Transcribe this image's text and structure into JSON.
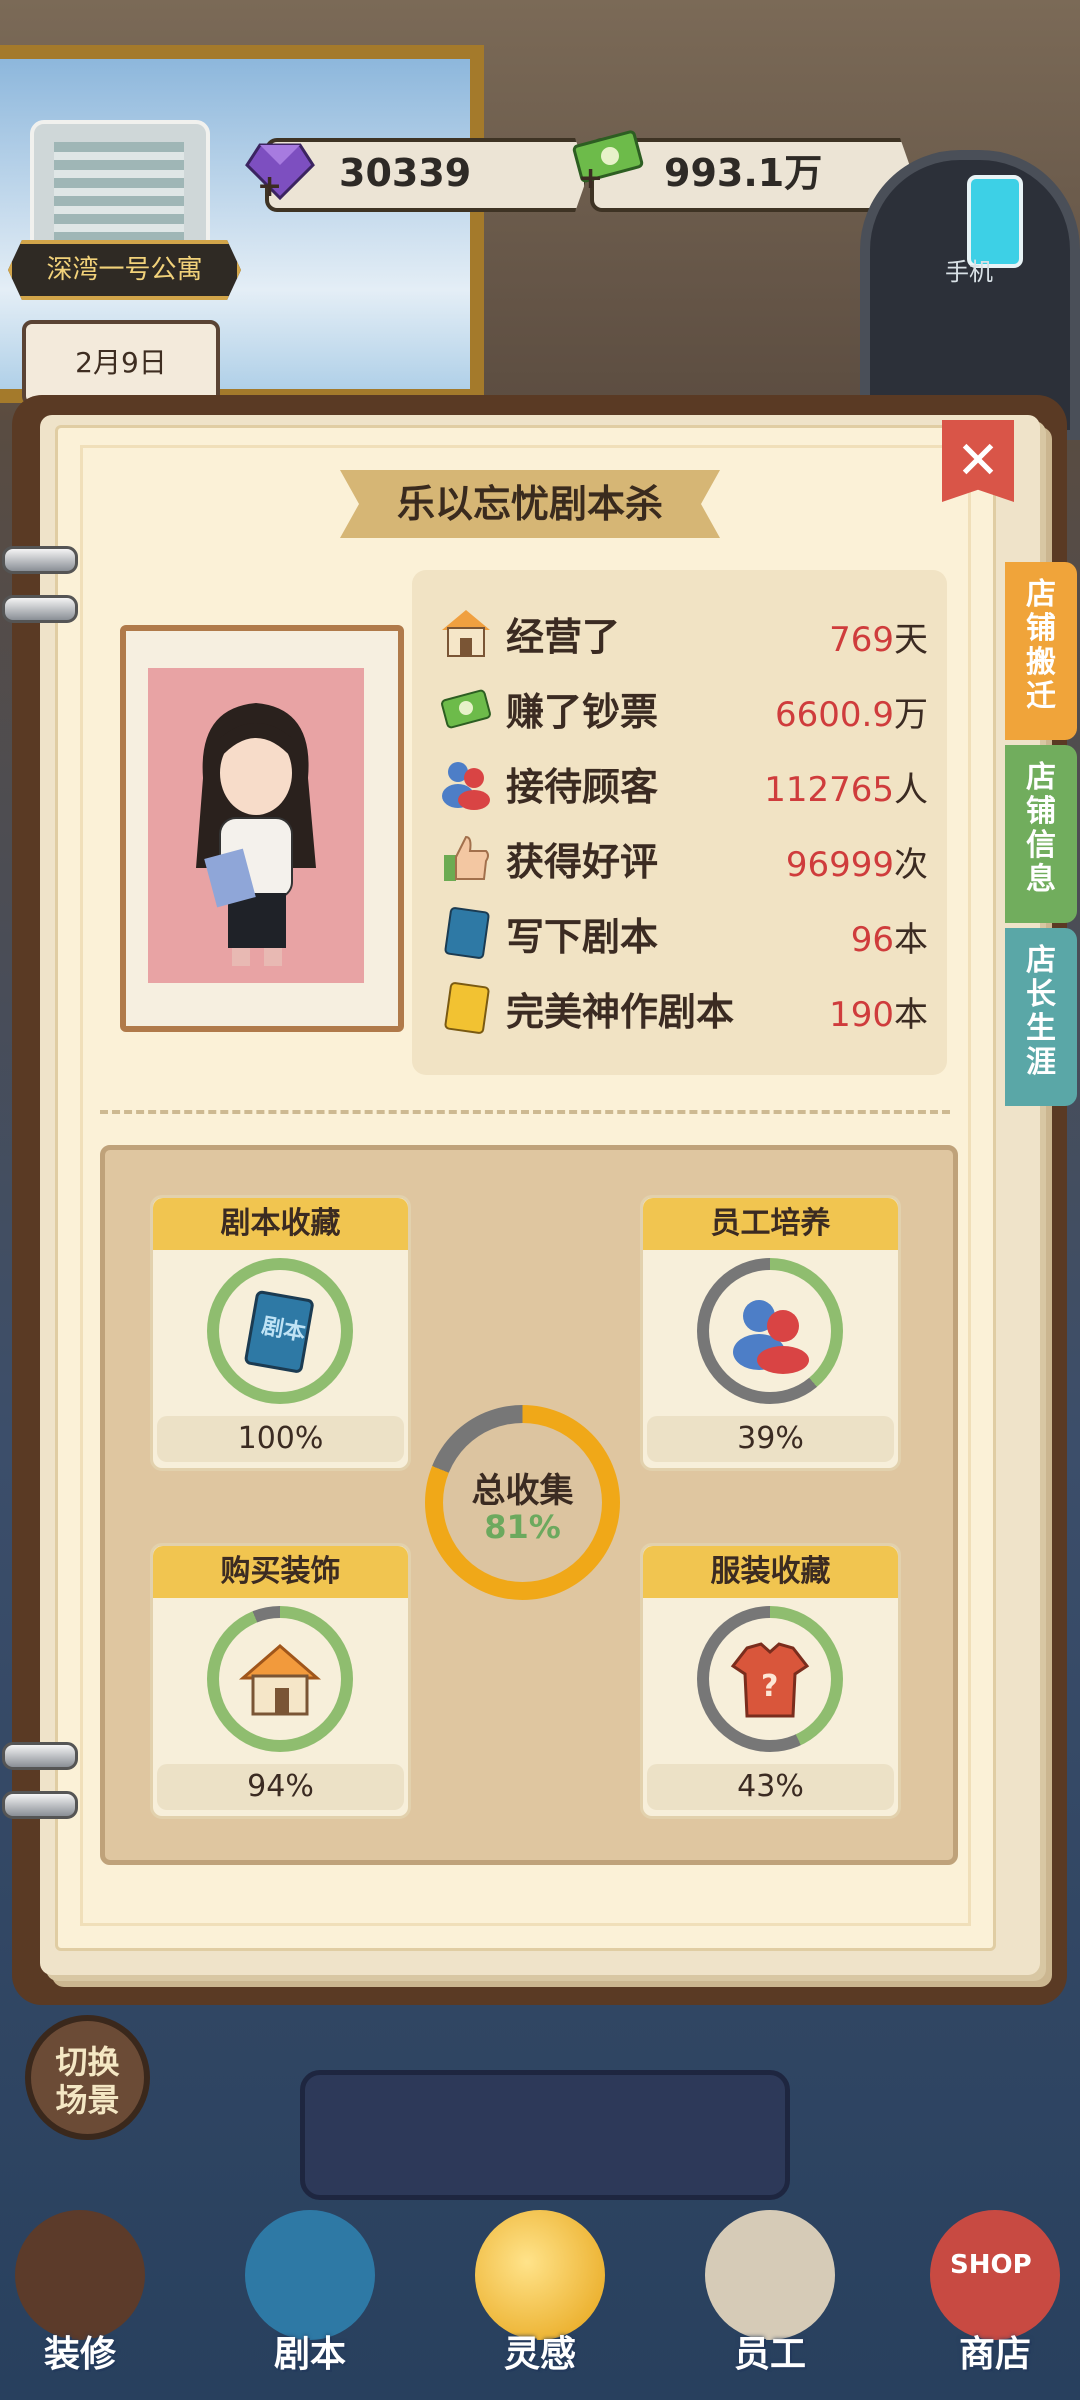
{
  "hud": {
    "location": "深湾一号公寓",
    "date": "2月9日",
    "gems": "30339",
    "money": "993.1万",
    "phone_label": "手机"
  },
  "book": {
    "close_glyph": "✕",
    "title": "乐以忘忧剧本杀",
    "tabs": [
      {
        "label": "店铺搬迁",
        "color": "#f0a43a"
      },
      {
        "label": "店铺信息",
        "color": "#71ad5d"
      },
      {
        "label": "店长生涯",
        "color": "#5aa7a7"
      }
    ],
    "stats": [
      {
        "icon": "shop-icon",
        "label": "经营了",
        "value": "769",
        "unit": "天"
      },
      {
        "icon": "cash-icon",
        "label": "赚了钞票",
        "value": "6600.9",
        "unit": "万"
      },
      {
        "icon": "customers-icon",
        "label": "接待顾客",
        "value": "112765",
        "unit": "人"
      },
      {
        "icon": "thumbs-up-icon",
        "label": "获得好评",
        "value": "96999",
        "unit": "次"
      },
      {
        "icon": "script-book-icon",
        "label": "写下剧本",
        "value": "96",
        "unit": "本"
      },
      {
        "icon": "gold-script-icon",
        "label": "完美神作剧本",
        "value": "190",
        "unit": "本"
      }
    ],
    "collections": [
      {
        "title": "剧本收藏",
        "percent": "100%",
        "fraction": 1.0,
        "icon": "script-book-icon"
      },
      {
        "title": "员工培养",
        "percent": "39%",
        "fraction": 0.39,
        "icon": "staff-icon"
      },
      {
        "title": "购买装饰",
        "percent": "94%",
        "fraction": 0.94,
        "icon": "house-icon"
      },
      {
        "title": "服装收藏",
        "percent": "43%",
        "fraction": 0.43,
        "icon": "shirt-icon"
      }
    ],
    "total": {
      "label": "总收集",
      "percent": "81%",
      "fraction": 0.81
    }
  },
  "bottom": {
    "switch_scene": "切换场景",
    "nav": [
      "装修",
      "剧本",
      "灵感",
      "员工",
      "商店"
    ],
    "shop_sign": "SHOP",
    "script_sign": "剧本"
  },
  "colors": {
    "accent_red": "#cf3c3c",
    "ring_green": "#8fbd6f",
    "ring_grey": "#777",
    "total_orange": "#f0a818"
  }
}
